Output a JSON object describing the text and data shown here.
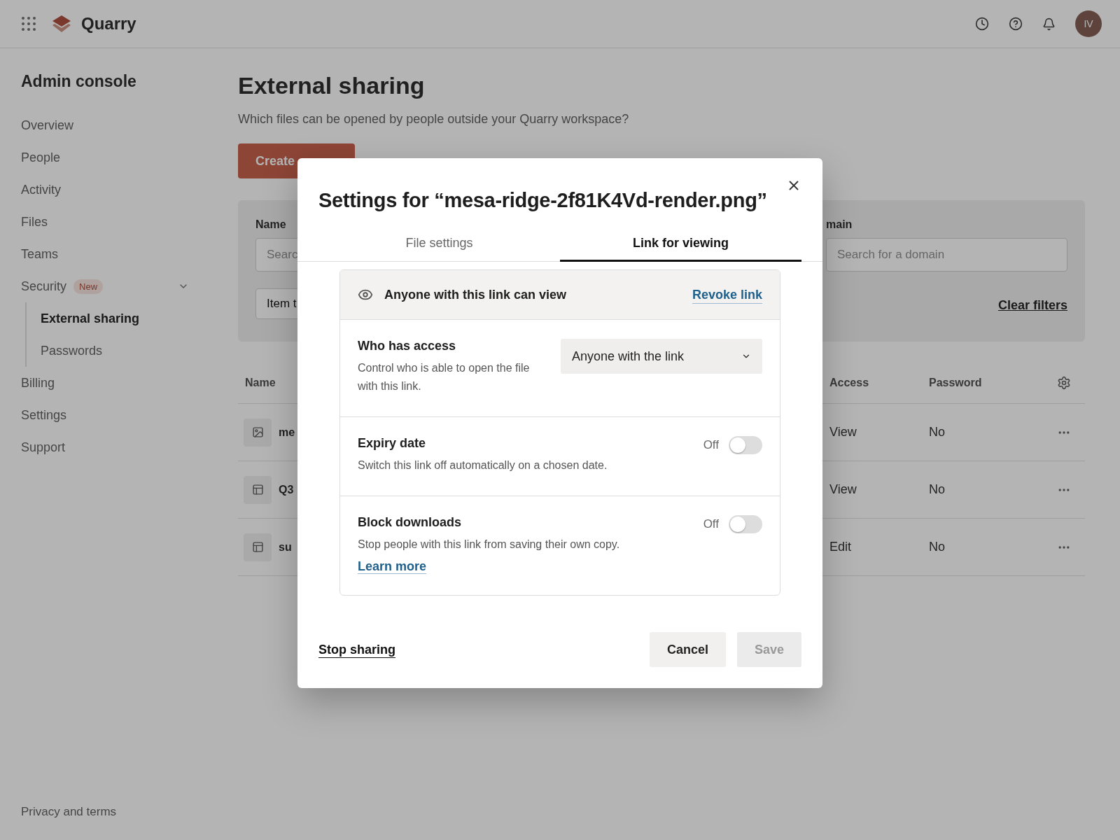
{
  "topbar": {
    "app_name": "Quarry",
    "avatar_initials": "IV"
  },
  "sidebar": {
    "title": "Admin console",
    "items": [
      {
        "label": "Overview",
        "selected": false
      },
      {
        "label": "People",
        "selected": false
      },
      {
        "label": "Activity",
        "selected": false
      },
      {
        "label": "Files",
        "selected": false
      },
      {
        "label": "Teams",
        "selected": false
      },
      {
        "label": "Security",
        "badge": "New",
        "selected": false,
        "expanded": true,
        "children": [
          {
            "label": "External sharing",
            "selected": true
          },
          {
            "label": "Passwords",
            "selected": false
          }
        ]
      },
      {
        "label": "Billing",
        "selected": false
      },
      {
        "label": "Settings",
        "selected": false
      },
      {
        "label": "Support",
        "selected": false
      }
    ],
    "footer_link": "Privacy and terms"
  },
  "page": {
    "title": "External sharing",
    "subtitle": "Which files can be opened by people outside your Quarry workspace?",
    "create_button": "Create",
    "filters": {
      "name_label": "Name",
      "name_placeholder": "Searc",
      "type_field": "Item t",
      "domain_label": "main",
      "domain_placeholder": "Search for a domain",
      "clear": "Clear filters"
    },
    "table": {
      "columns": [
        "Name",
        "Access",
        "Password"
      ],
      "rows": [
        {
          "kind": "image",
          "name": "me",
          "access": "View",
          "password": "No"
        },
        {
          "kind": "layout",
          "name": "Q3",
          "access": "View",
          "password": "No"
        },
        {
          "kind": "layout",
          "name": "su",
          "access": "Edit",
          "password": "No"
        }
      ]
    }
  },
  "dialog": {
    "title": "Settings for “mesa-ridge-2f81K4Vd-render.png”",
    "tabs": [
      {
        "label": "File settings",
        "selected": false
      },
      {
        "label": "Link for viewing",
        "selected": true
      }
    ],
    "banner": {
      "text": "Anyone with this link can view",
      "action": "Revoke link"
    },
    "settings": [
      {
        "kind": "select",
        "title": "Who has access",
        "description": "Control who is able to open the file with this link.",
        "value": "Anyone with the link"
      },
      {
        "kind": "toggle",
        "title": "Expiry date",
        "description": "Switch this link off automatically on a chosen date.",
        "state_label": "Off",
        "on": false
      },
      {
        "kind": "toggle",
        "title": "Block downloads",
        "description": "Stop people with this link from saving their own copy.",
        "link": "Learn more",
        "state_label": "Off",
        "on": false
      }
    ],
    "stop_sharing": "Stop sharing",
    "buttons": [
      {
        "label": "Cancel",
        "disabled": false
      },
      {
        "label": "Save",
        "disabled": true
      }
    ]
  }
}
